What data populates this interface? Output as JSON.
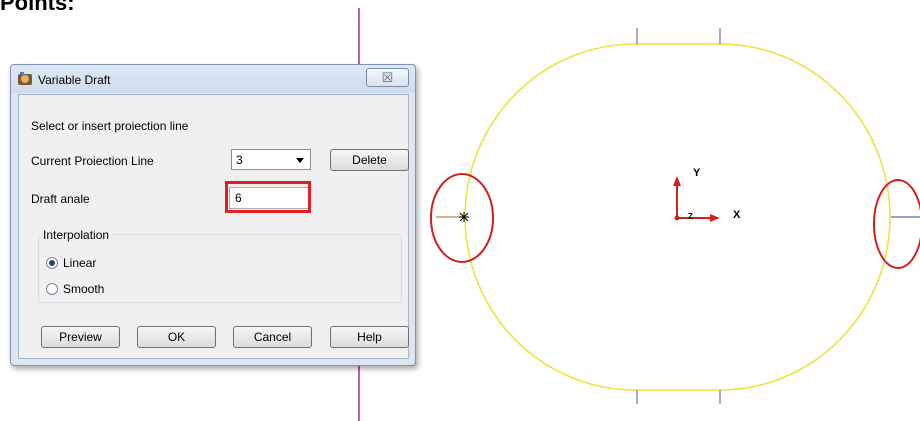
{
  "page": {
    "heading": "Points:"
  },
  "dialog": {
    "title": "Variable Draft",
    "close_label": "☒",
    "instruction": "Select or insert proiection line",
    "projection_label": "Current Proiection Line",
    "projection_value": "3",
    "delete_label": "Delete",
    "draft_angle_label": "Draft anale",
    "draft_angle_value": "6",
    "interpolation_title": "Interpolation",
    "linear_label": "Linear",
    "smooth_label": "Smooth",
    "interpolation_selected": "Linear",
    "buttons": {
      "preview": "Preview",
      "ok": "OK",
      "cancel": "Cancel",
      "help": "Help"
    }
  },
  "viewport": {
    "axis_y_label": "Y",
    "axis_x_label": "X",
    "axis_z_label": "Z",
    "colors": {
      "profile": "#f0e040",
      "annotation": "#d02020",
      "axis": "#d02020",
      "divider": "#9b2f8f"
    }
  }
}
